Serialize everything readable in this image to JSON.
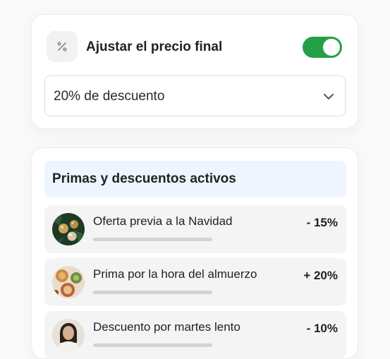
{
  "adjust": {
    "title": "Ajustar el precio final",
    "toggle_on": true,
    "toggle_color": "#24a148",
    "icon": "percent-icon",
    "discount_select": {
      "value": "20% de descuento",
      "icon": "chevron-down-icon"
    }
  },
  "active": {
    "title": "Primas y descuentos activos",
    "header_bg": "#eef5ff",
    "items": [
      {
        "label": "Oferta previa a la Navidad",
        "value": "- 15%",
        "thumb": "christmas-ornaments"
      },
      {
        "label": "Prima por la hora del almuerzo",
        "value": "+ 20%",
        "thumb": "lunch-dishes"
      },
      {
        "label": "Descuento por martes lento",
        "value": "- 10%",
        "thumb": "person-portrait"
      }
    ]
  }
}
